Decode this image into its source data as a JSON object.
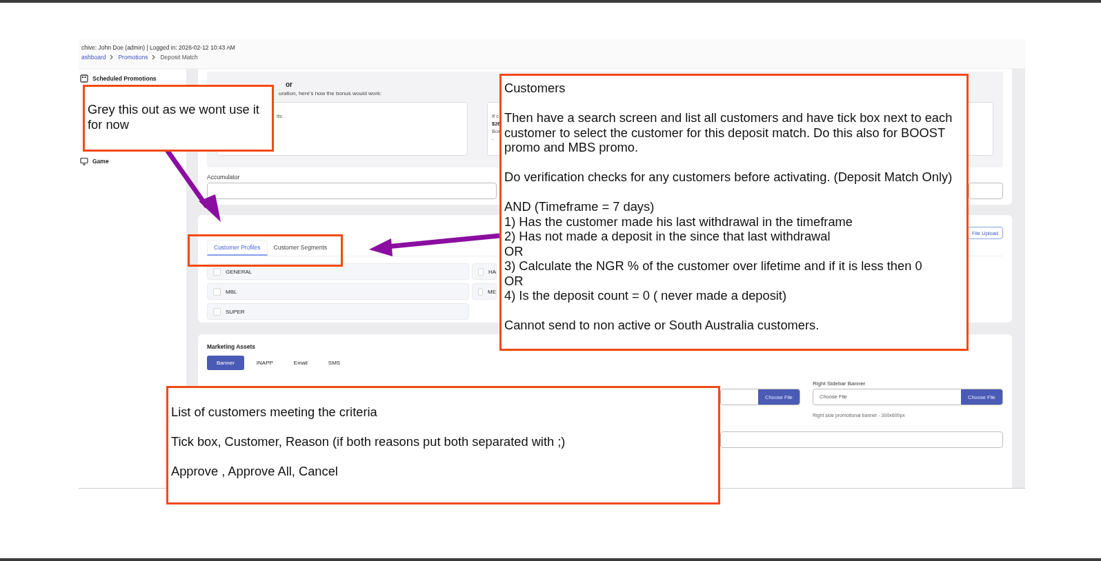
{
  "header": {
    "session": "chive: John Doe (admin) | Logged in: 2026-02-12 10:43 AM",
    "breadcrumb": [
      "ashboard",
      "Promotions",
      "Deposit Match"
    ]
  },
  "sidebar": {
    "items": [
      {
        "label": "Scheduled Promotions",
        "kind": "calendar"
      },
      {
        "label": "Game",
        "kind": "monitor"
      }
    ]
  },
  "calculator": {
    "title": "or",
    "subtitle": "uration, here's how the bonus would work:",
    "example_1": [
      "its:"
    ],
    "example_2": [
      "If c",
      "$26",
      "Bor",
      "-"
    ]
  },
  "accumulator": {
    "label": "Accumulator"
  },
  "eligibility": {
    "upload_button": "File Upload",
    "tabs": [
      {
        "label": "Customer Profiles",
        "selected": true
      },
      {
        "label": "Customer Segments",
        "selected": false
      }
    ],
    "profiles": [
      {
        "label": "GENERAL",
        "checked": false
      },
      {
        "label": "HA",
        "checked": false
      },
      {
        "label": "MBL",
        "checked": false
      },
      {
        "label": "ME",
        "checked": false
      },
      {
        "label": "SUPER",
        "checked": false
      }
    ]
  },
  "marketing": {
    "title": "Marketing Assets",
    "tabs": [
      {
        "label": "Banner",
        "selected": true
      },
      {
        "label": "INAPP",
        "selected": false
      },
      {
        "label": "Email",
        "selected": false
      },
      {
        "label": "SMS",
        "selected": false
      }
    ],
    "left_banner": {
      "button": "Choose File"
    },
    "right_banner": {
      "label": "Right Sidebar Banner",
      "placeholder": "Choose File",
      "button": "Choose File",
      "hint": "Right side promotional banner - 300x600px"
    }
  },
  "annotations": [
    {
      "kind": "note",
      "blocks": [
        [
          "Grey this out as we wont use it for now"
        ]
      ]
    },
    {
      "kind": "note",
      "blocks": [
        [
          "Customers"
        ],
        [
          "Then have a search screen and list all customers and have tick box next to each customer to select the customer for this deposit match. Do this also for BOOST promo and MBS promo."
        ],
        [
          "Do verification checks for any customers before activating. (Deposit Match Only)"
        ],
        [
          "AND (Timeframe = 7 days)",
          "1) Has the customer made his last withdrawal in the timeframe",
          "2) Has not made a deposit in the since that last withdrawal",
          "OR",
          "3) Calculate the NGR % of the customer over lifetime and if it is less then 0",
          "OR",
          "4) Is the deposit count = 0 ( never made a deposit)"
        ],
        [
          "Cannot send to non active or South Australia customers."
        ]
      ]
    },
    {
      "kind": "note",
      "blocks": [
        [
          "List of customers meeting the criteria"
        ],
        [
          "Tick box, Customer, Reason (if both reasons put both separated with ;)"
        ],
        [
          "Approve , Approve All, Cancel"
        ]
      ]
    },
    {
      "kind": "highlight"
    }
  ]
}
